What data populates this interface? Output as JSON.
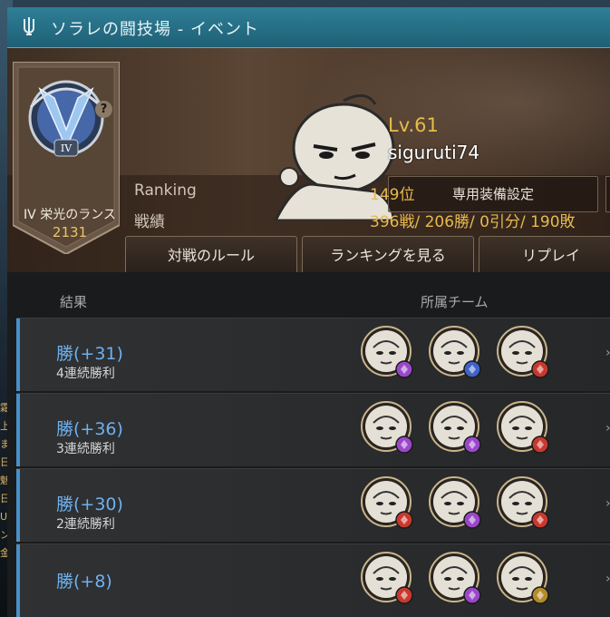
{
  "window": {
    "title": "ソラレの闘技場 - イベント"
  },
  "background": {
    "left_text": "霜\n上\nま\n日\n魅\n日\nU\nン\n金"
  },
  "profile": {
    "rank_name": "IV 栄光のランス",
    "rank_points": "2131",
    "help": "?",
    "level": "Lv.61",
    "player_name": "siguruti74",
    "equip_button": "専用装備設定",
    "ranking_label": "Ranking",
    "ranking_value": "149位",
    "record_label": "戦績",
    "record_value": "396戦/ 206勝/ 0引分/ 190敗"
  },
  "buttons": {
    "rules": "対戦のルール",
    "ranking": "ランキングを見る",
    "replay": "リプレイ"
  },
  "list": {
    "col_result": "結果",
    "col_team": "所属チーム",
    "rows": [
      {
        "result": "勝(+31)",
        "streak": "4連続勝利",
        "team": [
          "purple",
          "blue",
          "red"
        ]
      },
      {
        "result": "勝(+36)",
        "streak": "3連続勝利",
        "team": [
          "purple",
          "purple",
          "red"
        ]
      },
      {
        "result": "勝(+30)",
        "streak": "2連続勝利",
        "team": [
          "red",
          "purple",
          "red"
        ]
      },
      {
        "result": "勝(+8)",
        "streak": "",
        "team": [
          "red",
          "purple",
          "gold"
        ]
      }
    ]
  },
  "colors": {
    "accent": "#4a90c9",
    "gold": "#e6bc4a",
    "titlebar": "#2a7a92"
  }
}
